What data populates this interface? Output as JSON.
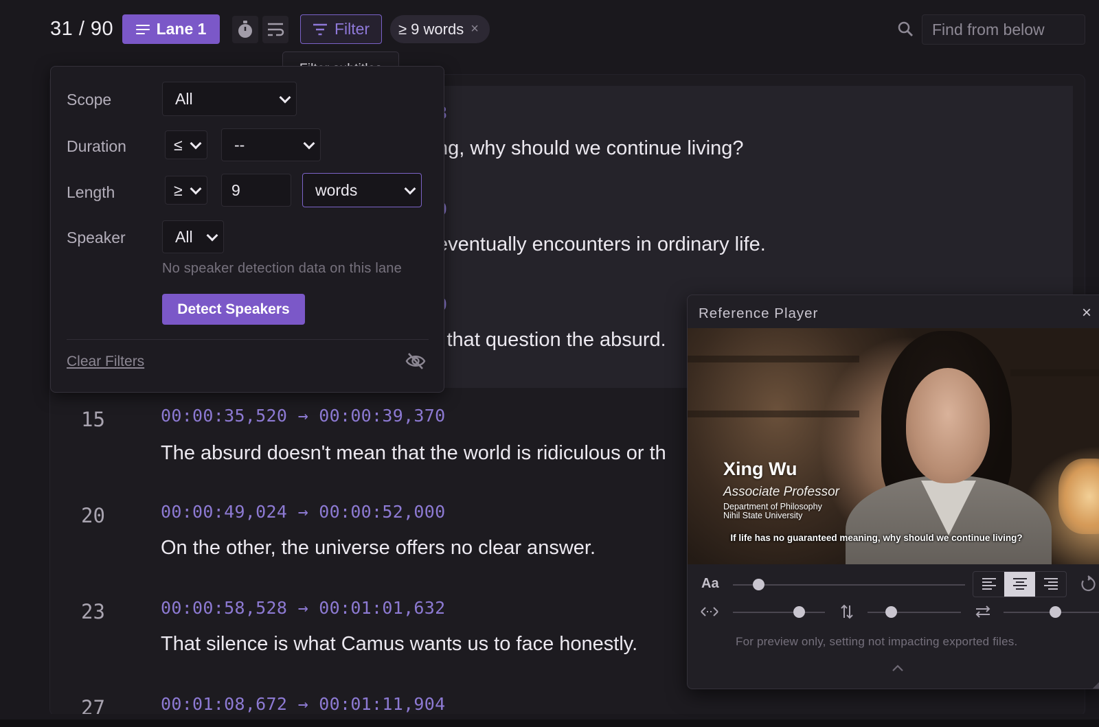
{
  "toolbar": {
    "counter": "31 / 90",
    "lane_label": "Lane 1",
    "filter_label": "Filter",
    "chip_label": "≥ 9 words",
    "chip_close": "×",
    "search_placeholder": "Find from below",
    "tooltip": "Filter subtitles"
  },
  "filter_panel": {
    "scope_label": "Scope",
    "scope_value": "All",
    "duration_label": "Duration",
    "duration_op": "≤",
    "duration_value": "--",
    "length_label": "Length",
    "length_op": "≥",
    "length_value": "9",
    "length_unit": "words",
    "speaker_label": "Speaker",
    "speaker_value": "All",
    "speaker_hint": "No speaker detection data on this lane",
    "detect_button": "Detect Speakers",
    "clear_filters": "Clear Filters"
  },
  "subtitles": {
    "partial_rows": [
      {
        "tc_tail": "8",
        "text": "ng, why should we continue living?"
      },
      {
        "tc_tail": "0",
        "text": "eventually encounters in ordinary life."
      },
      {
        "tc_tail": "0",
        "text": "l that question the absurd."
      }
    ],
    "rows": [
      {
        "num": "15",
        "timecode": "00:00:35,520 → 00:00:39,370",
        "text": "The absurd doesn't mean that the world is ridiculous or th"
      },
      {
        "num": "20",
        "timecode": "00:00:49,024 → 00:00:52,000",
        "text": "On the other, the universe offers no clear answer."
      },
      {
        "num": "23",
        "timecode": "00:00:58,528 → 00:01:01,632",
        "text": "That silence is what Camus wants us to face honestly."
      },
      {
        "num": "27",
        "timecode": "00:01:08,672 → 00:01:11,904",
        "text": ""
      }
    ]
  },
  "player": {
    "title": "Reference Player",
    "close": "×",
    "lower_third": {
      "name": "Xing Wu",
      "role": "Associate Professor",
      "dept_line1": "Department of Philosophy",
      "dept_line2": "Nihil State University"
    },
    "caption": "If life has no guaranteed meaning, why should we continue living?",
    "font_size_label": "Aa",
    "font_size_level": 0.11,
    "horizontal_level": 0.72,
    "vertical_level": 0.25,
    "spacing_level": 0.5,
    "alignment_selected": "center",
    "preview_note": "For preview only, setting not impacting exported files."
  },
  "colors": {
    "accent": "#7b58c8",
    "timecode": "#8d7ad3",
    "background": "#1a181d"
  }
}
